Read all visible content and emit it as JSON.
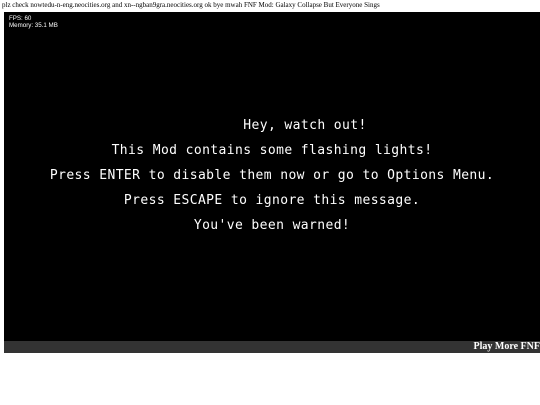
{
  "header_text": "plz check nowtedu-n-eng.neocities.org and xn--ngban9gra.neocities.org ok bye mwah FNF Mod: Galaxy Collapse But Everyone Sings",
  "debug": {
    "fps": "FPS: 60",
    "memory": "Memory: 35.1 MB"
  },
  "warning": {
    "lines": [
      "Hey, watch out!",
      "This Mod contains some flashing lights!",
      "Press ENTER to disable them now or go to Options Menu.",
      "Press ESCAPE to ignore this message.",
      "You've been warned!"
    ]
  },
  "footer": {
    "play_more_label": "Play More FNF"
  },
  "colors": {
    "game_background": "#000000",
    "footer_bar": "#333333",
    "text": "#ffffff"
  }
}
